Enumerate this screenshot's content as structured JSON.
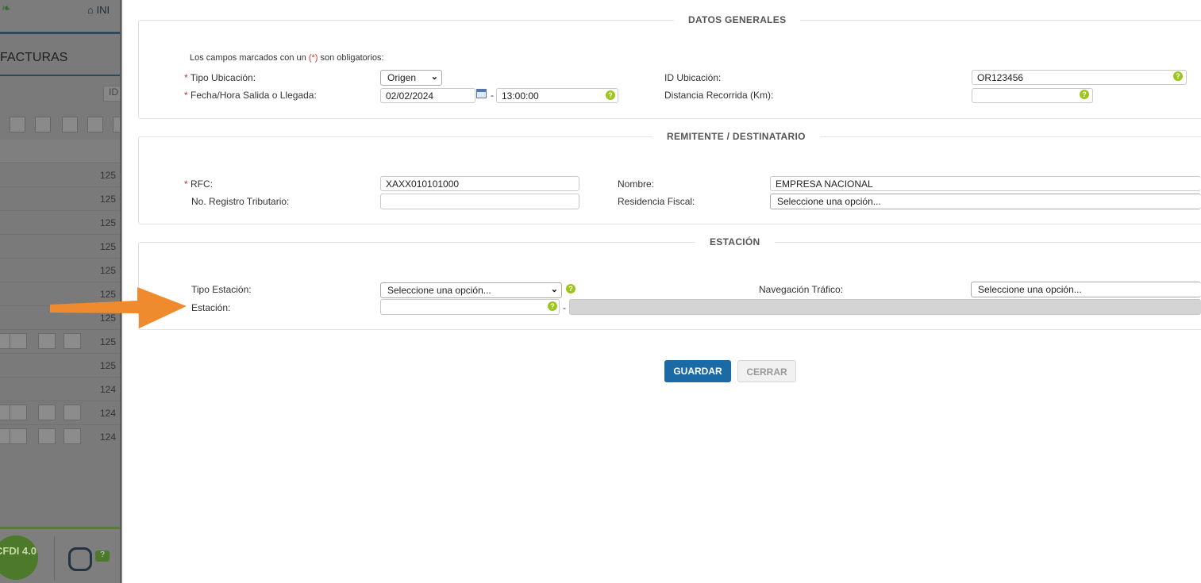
{
  "background": {
    "home_label": "INI",
    "section_title": "FACTURAS",
    "id_filter_label": "ID",
    "row_numbers": [
      "125",
      "125",
      "125",
      "125",
      "125",
      "125",
      "125",
      "125",
      "125",
      "124",
      "124",
      "124"
    ],
    "cfdi_badge": "CFDI 4.0",
    "bot_badge": "?"
  },
  "sections": {
    "datos_generales": "DATOS GENERALES",
    "remitente": "REMITENTE / DESTINATARIO",
    "estacion": "ESTACIÓN"
  },
  "datos_generales": {
    "required_note_prefix": "Los campos marcados con un ",
    "required_mark": "(*)",
    "required_note_suffix": " son obligatorios:",
    "asterisk": "*",
    "tipo_ubicacion_label": "Tipo Ubicación:",
    "tipo_ubicacion_value": "Origen",
    "fecha_label": "Fecha/Hora Salida o Llegada:",
    "fecha_value": "02/02/2024",
    "separator": "-",
    "hora_value": "13:00:00",
    "id_ubicacion_label": "ID Ubicación:",
    "id_ubicacion_value": "OR123456",
    "distancia_label": "Distancia Recorrida (Km):",
    "distancia_value": ""
  },
  "remitente": {
    "asterisk": "*",
    "rfc_label": "RFC:",
    "rfc_value": "XAXX010101000",
    "nombre_label": "Nombre:",
    "nombre_value": "EMPRESA NACIONAL",
    "registro_label": "No. Registro Tributario:",
    "registro_value": "",
    "residencia_label": "Residencia Fiscal:",
    "residencia_value": "Seleccione una opción..."
  },
  "estacion": {
    "tipo_label": "Tipo Estación:",
    "tipo_value": "Seleccione una opción...",
    "navegacion_label": "Navegación Tráfico:",
    "navegacion_value": "Seleccione una opción...",
    "estacion_label": "Estación:",
    "estacion_value": "",
    "separator": "-"
  },
  "help_glyph": "?",
  "buttons": {
    "guardar": "GUARDAR",
    "cerrar": "CERRAR"
  },
  "colors": {
    "primary_button": "#1a6aa5",
    "help_icon": "#9ec51e",
    "required": "#c0392b",
    "arrow": "#f08a2e"
  }
}
